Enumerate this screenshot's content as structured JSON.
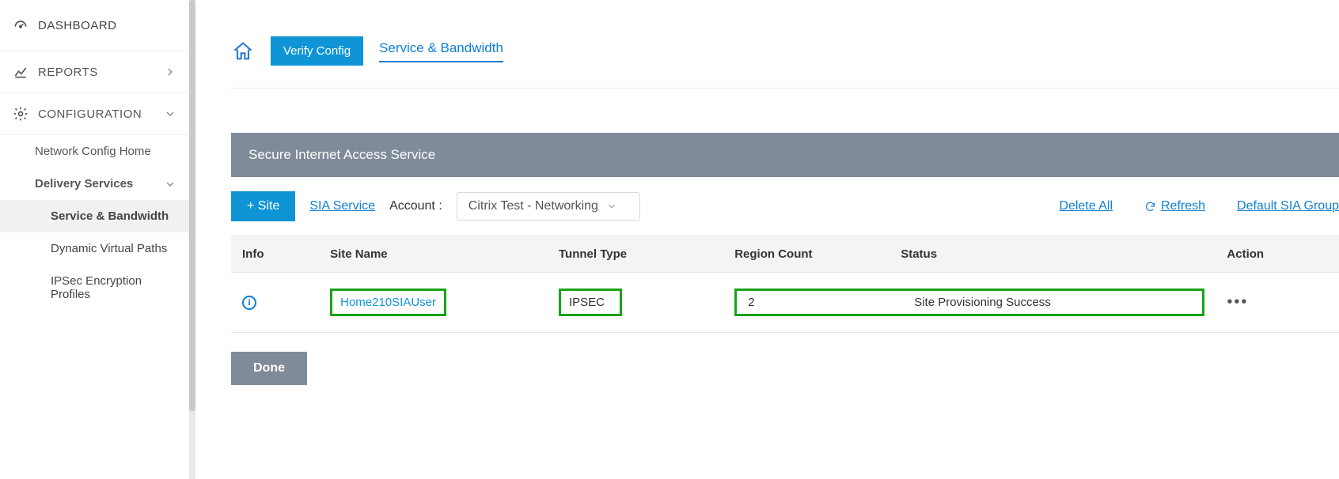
{
  "sidebar": {
    "dashboard": "DASHBOARD",
    "reports": "REPORTS",
    "configuration": "CONFIGURATION",
    "network_config_home": "Network Config Home",
    "delivery_services": "Delivery Services",
    "service_bandwidth": "Service & Bandwidth",
    "dynamic_virtual_paths": "Dynamic Virtual Paths",
    "ipsec_profiles": "IPSec Encryption Profiles"
  },
  "breadcrumb": {
    "verify": "Verify Config",
    "current": "Service & Bandwidth"
  },
  "panel": {
    "title": "Secure Internet Access Service"
  },
  "toolbar": {
    "add_site": "+ Site",
    "sia_service": "SIA Service",
    "account_label": "Account :",
    "account_value": "Citrix Test - Networking",
    "delete_all": "Delete All",
    "refresh": "Refresh",
    "default_group": "Default SIA Group"
  },
  "table": {
    "headers": {
      "info": "Info",
      "site_name": "Site Name",
      "tunnel_type": "Tunnel Type",
      "region_count": "Region Count",
      "status": "Status",
      "action": "Action"
    },
    "rows": [
      {
        "site_name": "Home210SIAUser",
        "tunnel_type": "IPSEC",
        "region_count": "2",
        "status": "Site Provisioning Success"
      }
    ]
  },
  "buttons": {
    "done": "Done"
  }
}
